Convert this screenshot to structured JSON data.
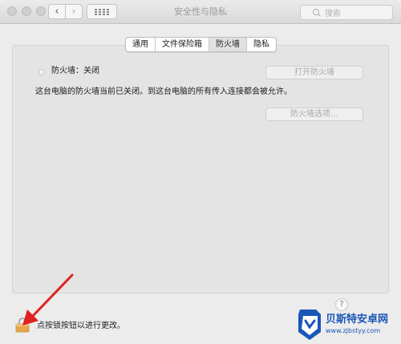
{
  "window": {
    "title": "安全性与隐私"
  },
  "toolbar": {
    "back_glyph": "‹",
    "forward_glyph": "›"
  },
  "search": {
    "placeholder": "搜索",
    "icon": "search-icon"
  },
  "tabs": [
    {
      "label": "通用",
      "selected": false
    },
    {
      "label": "文件保险箱",
      "selected": false
    },
    {
      "label": "防火墙",
      "selected": true
    },
    {
      "label": "隐私",
      "selected": false
    }
  ],
  "firewall": {
    "status_text": "防火墙：关闭",
    "open_button": "打开防火墙",
    "description": "这台电脑的防火墙当前已关闭。到这台电脑的所有传入连接都会被允许。",
    "options_button": "防火墙选项…"
  },
  "footer": {
    "lock_text": "点按锁按钮以进行更改。",
    "help_glyph": "?"
  },
  "watermark": {
    "title": "贝斯特安卓网",
    "url": "www.zjbstyy.com"
  },
  "colors": {
    "annotation_arrow": "#e02020",
    "lock": "#e8a64a",
    "watermark_blue": "#1a56b8"
  }
}
